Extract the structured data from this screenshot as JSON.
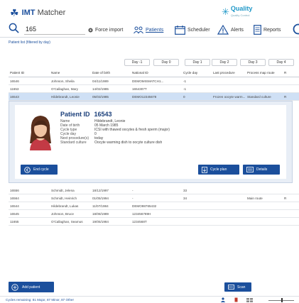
{
  "app": {
    "name_bold": "IMT",
    "name_light": "Matcher"
  },
  "quality": {
    "title": "Quality",
    "subtitle": "Quality Control"
  },
  "search": {
    "value": "165"
  },
  "toolbar": {
    "force_import": "Force import",
    "patients": "Patients",
    "scheduler": "Scheduler",
    "alerts": "Alerts",
    "reports": "Reports"
  },
  "filter_caption": "Patient list (filtered by day)",
  "day_buttons": [
    "Day -1",
    "Day 0",
    "Day 1",
    "Day 2",
    "Day 3",
    "Day 4"
  ],
  "table": {
    "headers": [
      "Patient ID",
      "Name",
      "Date of birth",
      "National ID",
      "Cycle day",
      "Last procedure",
      "Process map route",
      "R"
    ],
    "rows_top": [
      [
        "16546",
        "Johnson, Sheila",
        "04/11/1989",
        "DEMOMISMATCH1...",
        "-1",
        "",
        "",
        ""
      ],
      [
        "11653",
        "O'Callaghan, Mary",
        "14/02/1985",
        "1654307T",
        "-1",
        "",
        "",
        ""
      ],
      [
        "16543",
        "Hildebrandt, Leonie",
        "05/03/1985",
        "DEMO12345678",
        "0",
        "Frozen oocyte warm...",
        "Standard culture",
        "R"
      ]
    ],
    "rows_bottom": [
      [
        "16556",
        "Schmidt, Jelena",
        "18/12/1997",
        "-",
        "33",
        "",
        "",
        ""
      ],
      [
        "16564",
        "Schmidt, Heinrich",
        "01/05/1994",
        "-",
        "34",
        "",
        "Main route",
        "R"
      ],
      [
        "16544",
        "Hildebrandt, Lukas",
        "11/07/1984",
        "DEMO98765432",
        "",
        "",
        "",
        ""
      ],
      [
        "16545",
        "Johnson, Bruce",
        "18/08/1989",
        "123456789H",
        "",
        "",
        "",
        ""
      ],
      [
        "11655",
        "O'Callaghan, Seamus",
        "19/05/1984",
        "1234568T",
        "",
        "",
        "",
        ""
      ]
    ]
  },
  "detail": {
    "title_label": "Patient ID",
    "title_id": "16543",
    "fields": [
      {
        "label": "Name",
        "value": "Hildebrandt, Leonie"
      },
      {
        "label": "Date of birth",
        "value": "05 March 1985"
      },
      {
        "label": "Cycle type",
        "value": "ICSI with thawed oocytes & fresh sperm (major)"
      },
      {
        "label": "Cycle day",
        "value": "0"
      },
      {
        "label": "Next procedure(s)",
        "value": "today"
      },
      {
        "label": "Standard culture",
        "value": "Oocyte warming dish to oocyte culture dish"
      }
    ],
    "end_cycle": "End cycle",
    "cycle_plan": "Cycle plan",
    "details": "Details"
  },
  "footer": {
    "add_patient": "Add patient",
    "scan": "Scan",
    "status": "Cycles remaining: 81 Major, 87 Minor, 87 Other"
  },
  "colors": {
    "accent": "#1b4f9c",
    "selected_row": "#cfe0f5",
    "quality": "#1f98c8"
  },
  "icons": [
    "logo-icon",
    "quality-icon",
    "search-icon",
    "force-import-icon",
    "patients-icon",
    "scheduler-icon",
    "alerts-icon",
    "reports-icon",
    "settings-icon",
    "end-cycle-icon",
    "cycle-plan-icon",
    "details-icon",
    "add-patient-icon",
    "scan-icon"
  ]
}
